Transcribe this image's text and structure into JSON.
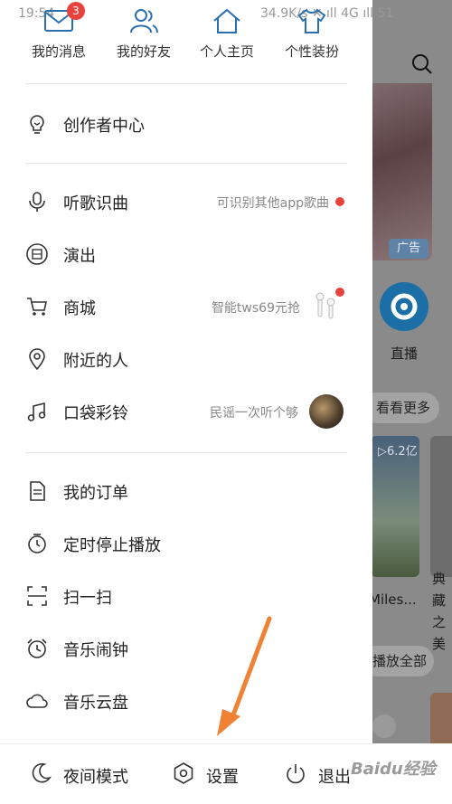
{
  "status_bar": {
    "time": "19:54",
    "right": "34.9K/s  ✕  ıll 4G ıll 51"
  },
  "top_nav": [
    {
      "label": "我的消息",
      "badge": "3"
    },
    {
      "label": "我的好友"
    },
    {
      "label": "个人主页"
    },
    {
      "label": "个性装扮"
    }
  ],
  "menu": {
    "creator": "创作者中心",
    "recognize": {
      "label": "听歌识曲",
      "hint": "可识别其他app歌曲"
    },
    "shows": "演出",
    "mall": {
      "label": "商城",
      "hint": "智能tws69元抢"
    },
    "nearby": "附近的人",
    "ringtone": {
      "label": "口袋彩铃",
      "hint": "民谣一次听个够"
    },
    "orders": "我的订单",
    "timer": "定时停止播放",
    "scan": "扫一扫",
    "alarm": "音乐闹钟",
    "cloud": "音乐云盘"
  },
  "bottom_bar": {
    "night": "夜间模式",
    "settings": "设置",
    "logout": "退出"
  },
  "background": {
    "ad": "广告",
    "live": "直播",
    "more": "看看更多",
    "plays": "▷6.2亿",
    "title1": "Miles...",
    "title2": "典藏之美",
    "play_all": "播放全部"
  },
  "watermark": "Baidu经验",
  "colors": {
    "badge": "#e8423f",
    "accent_arrow": "#f08236"
  }
}
